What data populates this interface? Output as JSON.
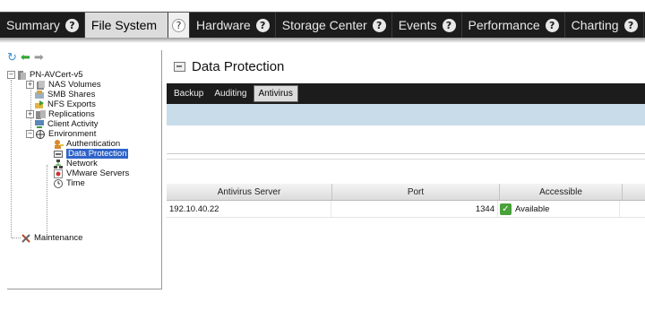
{
  "top_tabs": [
    {
      "label": "Summary",
      "active": false,
      "help": "?"
    },
    {
      "label": "File System",
      "active": true,
      "help": "?"
    },
    {
      "label": "",
      "active": false,
      "help": "?"
    },
    {
      "label": "Hardware",
      "active": false,
      "help": "?"
    },
    {
      "label": "Storage Center",
      "active": false,
      "help": "?"
    },
    {
      "label": "Events",
      "active": false,
      "help": "?"
    },
    {
      "label": "Performance",
      "active": false,
      "help": "?"
    },
    {
      "label": "Charting",
      "active": false,
      "help": "?"
    }
  ],
  "tree": {
    "toolbar": [
      "refresh-icon",
      "back-arrow-icon",
      "forward-arrow-icon"
    ],
    "root": "PN-AVCert-v5",
    "items": {
      "nas_volumes": "NAS Volumes",
      "smb_shares": "SMB Shares",
      "nfs_exports": "NFS Exports",
      "replications": "Replications",
      "client_activity": "Client Activity",
      "environment": "Environment",
      "authentication": "Authentication",
      "data_protection": "Data Protection",
      "network": "Network",
      "vmware_servers": "VMware Servers",
      "time": "Time",
      "maintenance": "Maintenance"
    },
    "expanders": {
      "root": "−",
      "nas_volumes": "+",
      "replications": "+",
      "environment": "−"
    }
  },
  "page_title": "Data Protection",
  "sub_tabs": [
    "Backup",
    "Auditing",
    "Antivirus"
  ],
  "active_sub_tab": "Antivirus",
  "table": {
    "headers": [
      "Antivirus Server",
      "Port",
      "Accessible"
    ],
    "rows": [
      {
        "server": "192.10.40.22",
        "port": "1344",
        "status_icon": "✓",
        "accessible": "Available"
      }
    ]
  },
  "colors": {
    "tab_bar": "#1c1c1c",
    "selection": "#2f63c9",
    "info_bar": "#c8dcea",
    "available": "#4aa23a"
  }
}
